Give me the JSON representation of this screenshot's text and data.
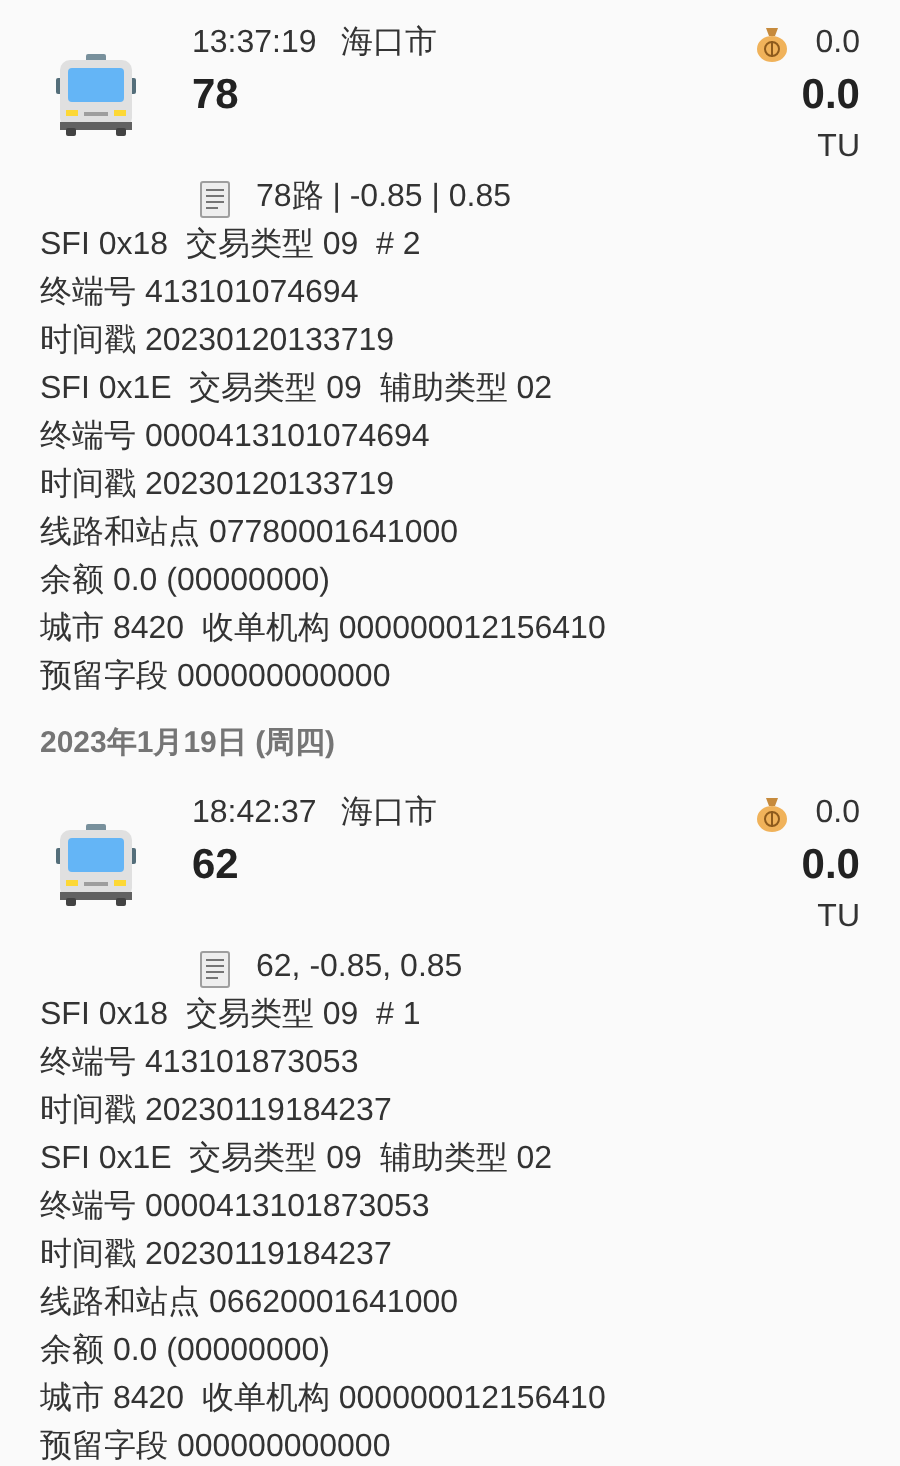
{
  "items": [
    {
      "kind": "record",
      "time": "13:37:19",
      "city": "海口市",
      "title": "78",
      "balance": "0.0",
      "amount": "0.0",
      "unit": "TU",
      "memo": "78路 | -0.85 | 0.85",
      "details": [
        "SFI 0x18  交易类型 09  # 2",
        "终端号 413101074694",
        "时间戳 20230120133719",
        "SFI 0x1E  交易类型 09  辅助类型 02",
        "终端号 0000413101074694",
        "时间戳 20230120133719",
        "线路和站点 07780001641000",
        "余额 0.0 (00000000)",
        "城市 8420  收单机构 000000012156410",
        "预留字段 000000000000"
      ]
    },
    {
      "kind": "date",
      "text": "2023年1月19日 (周四)"
    },
    {
      "kind": "record",
      "time": "18:42:37",
      "city": "海口市",
      "title": "62",
      "balance": "0.0",
      "amount": "0.0",
      "unit": "TU",
      "memo": "62, -0.85, 0.85",
      "details": [
        "SFI 0x18  交易类型 09  # 1",
        "终端号 413101873053",
        "时间戳 20230119184237",
        "SFI 0x1E  交易类型 09  辅助类型 02",
        "终端号 0000413101873053",
        "时间戳 20230119184237",
        "线路和站点 06620001641000",
        "余额 0.0 (00000000)",
        "城市 8420  收单机构 000000012156410",
        "预留字段 000000000000"
      ]
    }
  ]
}
